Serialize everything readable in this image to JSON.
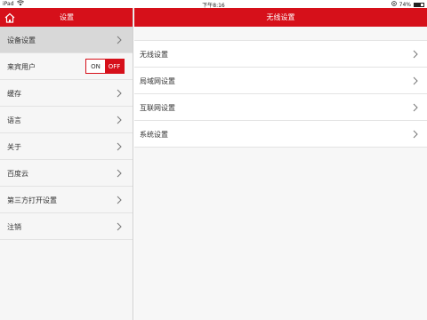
{
  "status_bar": {
    "carrier": "iPad",
    "time": "下午8:16",
    "battery": "74%",
    "battery_level": 0.74
  },
  "left_panel": {
    "header_title": "设置",
    "items": [
      {
        "label": "设备设置"
      },
      {
        "label": "来宾用户",
        "toggle_on_label": "ON",
        "toggle_off_label": "OFF"
      },
      {
        "label": "缓存"
      },
      {
        "label": "语言"
      },
      {
        "label": "关于"
      },
      {
        "label": "百度云"
      },
      {
        "label": "第三方打开设置"
      },
      {
        "label": "注销"
      }
    ]
  },
  "right_panel": {
    "header_title": "无线设置",
    "items": [
      {
        "label": "无线设置"
      },
      {
        "label": "局域网设置"
      },
      {
        "label": "互联网设置"
      },
      {
        "label": "系统设置"
      }
    ]
  },
  "colors": {
    "accent": "#d6101a"
  }
}
